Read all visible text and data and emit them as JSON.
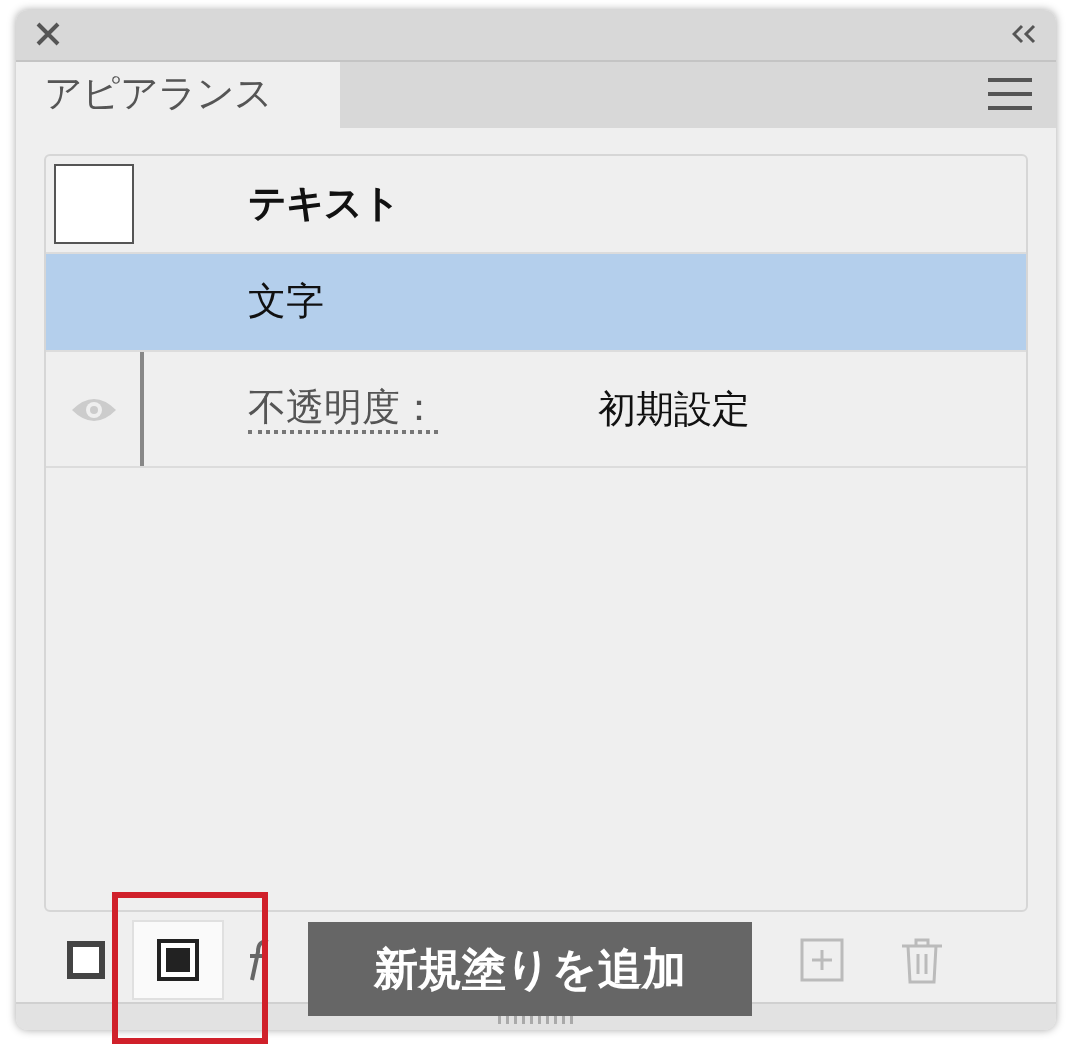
{
  "panel": {
    "tabs": [
      {
        "label": "アピアランス",
        "selected": true
      }
    ]
  },
  "rows": [
    {
      "kind": "header",
      "label": "テキスト",
      "selected": false
    },
    {
      "kind": "item",
      "label": "文字",
      "selected": true
    },
    {
      "kind": "attribute",
      "label": "不透明度：",
      "value": "初期設定",
      "selected": false
    }
  ],
  "toolbar": [
    {
      "kind": "stroke"
    },
    {
      "kind": "fill"
    },
    {
      "kind": "fx"
    },
    {
      "kind": "duplicate"
    },
    {
      "kind": "delete"
    }
  ],
  "tooltip": "新規塗りを追加"
}
